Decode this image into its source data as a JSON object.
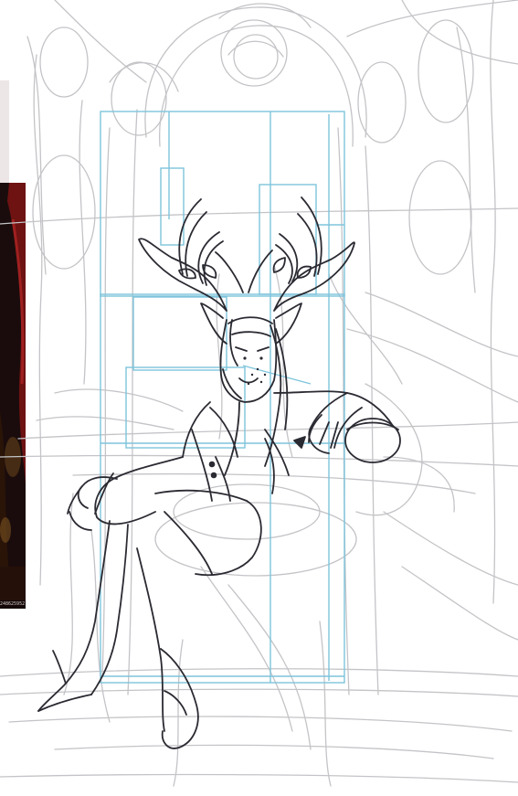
{
  "artwork": {
    "subject": "sketch-antlered-figure-on-throne",
    "colors": {
      "paper": "#ffffff",
      "rough_sketch": "#c4c4c8",
      "guide_lines": "#7ec4dc",
      "ink_lines": "#2a2a32",
      "reference_photo": "#1a0c0c",
      "reference_accent": "#8a1a1a"
    }
  },
  "reference_image": {
    "caption": "248625952"
  }
}
